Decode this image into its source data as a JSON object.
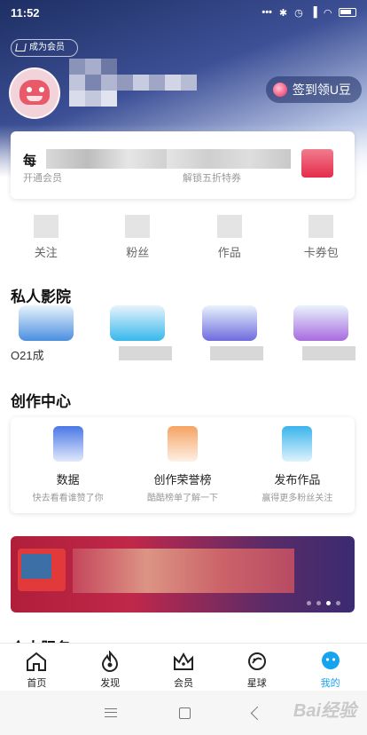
{
  "status_bar": {
    "time": "11:52",
    "icons": [
      "dots-icon",
      "bluetooth-icon",
      "alarm-icon",
      "signal-icon",
      "wifi-icon",
      "battery-icon"
    ],
    "dots_text": "•••"
  },
  "profile": {
    "vip_badge": "成为会员",
    "checkin_label": "签到领U豆"
  },
  "vip_card": {
    "title": "每",
    "subtitle_left": "开通会员",
    "subtitle_right": "解锁五折特券"
  },
  "stats": [
    {
      "label": "关注"
    },
    {
      "label": "粉丝"
    },
    {
      "label": "作品"
    },
    {
      "label": "卡券包"
    }
  ],
  "private_cinema": {
    "title": "私人影院",
    "items": [
      {
        "label": "O21成",
        "color": "#4a8fe0"
      },
      {
        "label": "",
        "color": "#37b8ec"
      },
      {
        "label": "",
        "color": "#6f6bde"
      },
      {
        "label": "",
        "color": "#a86be0"
      }
    ]
  },
  "creator_center": {
    "title": "创作中心",
    "items": [
      {
        "title": "数据",
        "subtitle": "快去看看谁赞了你",
        "color": "#4a78e6"
      },
      {
        "title": "创作荣誉榜",
        "subtitle": "酷酷榜单了解一下",
        "color": "#f5a462"
      },
      {
        "title": "发布作品",
        "subtitle": "赢得更多粉丝关注",
        "color": "#3ab4ec"
      }
    ]
  },
  "banner": {
    "slides": 4,
    "active_slide": 2
  },
  "more_section": {
    "title": "个人服务"
  },
  "tabbar": {
    "items": [
      {
        "label": "首页",
        "icon": "home-icon"
      },
      {
        "label": "发现",
        "icon": "discover-icon"
      },
      {
        "label": "会员",
        "icon": "crown-icon"
      },
      {
        "label": "星球",
        "icon": "planet-icon"
      },
      {
        "label": "我的",
        "icon": "profile-icon"
      }
    ],
    "active_index": 4,
    "active_color": "#16a3f0"
  },
  "watermark": "Bai经验"
}
